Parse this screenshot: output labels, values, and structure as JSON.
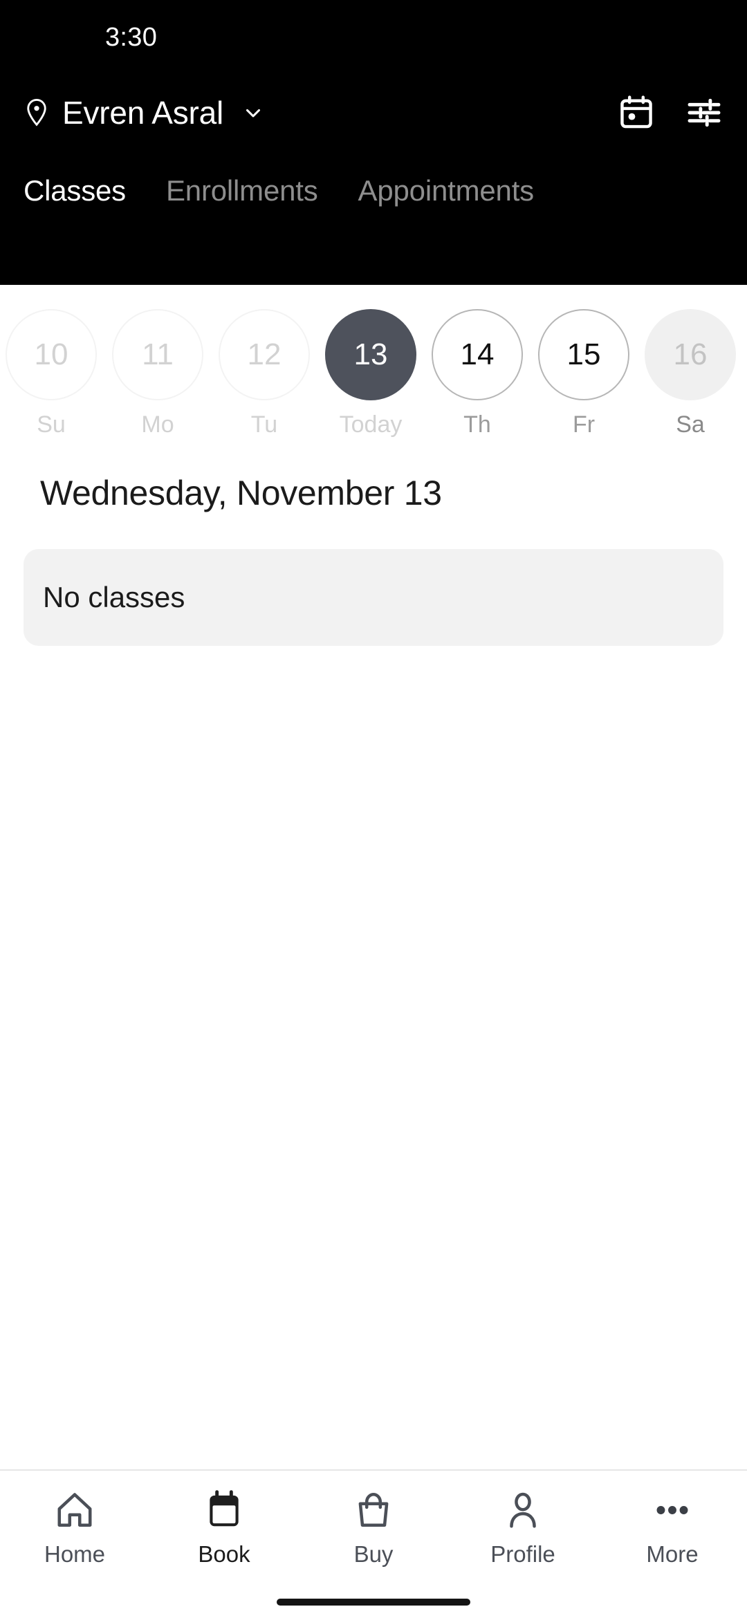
{
  "status_bar": {
    "time": "3:30"
  },
  "app_bar": {
    "pin_icon": "location-pin-icon",
    "location_name": "Evren Asral",
    "chevron_icon": "chevron-down-icon",
    "calendar_icon": "calendar-icon",
    "filter_icon": "filter-sliders-icon"
  },
  "tabs": [
    {
      "label": "Classes",
      "active": true
    },
    {
      "label": "Enrollments",
      "active": false
    },
    {
      "label": "Appointments",
      "active": false
    }
  ],
  "date_strip": [
    {
      "day_number": "10",
      "day_label": "Su",
      "state": "past"
    },
    {
      "day_number": "11",
      "day_label": "Mo",
      "state": "past"
    },
    {
      "day_number": "12",
      "day_label": "Tu",
      "state": "past"
    },
    {
      "day_number": "13",
      "day_label": "Today",
      "state": "today"
    },
    {
      "day_number": "14",
      "day_label": "Th",
      "state": "available"
    },
    {
      "day_number": "15",
      "day_label": "Fr",
      "state": "available"
    },
    {
      "day_number": "16",
      "day_label": "Sa",
      "state": "weekend"
    }
  ],
  "main": {
    "date_heading": "Wednesday, November 13",
    "empty_state": "No classes"
  },
  "bottom_nav": [
    {
      "label": "Home",
      "icon": "home-icon",
      "active": false
    },
    {
      "label": "Book",
      "icon": "calendar-filled-icon",
      "active": true
    },
    {
      "label": "Buy",
      "icon": "shopping-bag-icon",
      "active": false
    },
    {
      "label": "Profile",
      "icon": "person-icon",
      "active": false
    },
    {
      "label": "More",
      "icon": "more-dots-icon",
      "active": false
    }
  ],
  "colors": {
    "header_bg": "#000000",
    "selected_day": "#4e525c",
    "card_bg": "#f2f2f2",
    "tab_inactive": "#8e8e8e",
    "weekend_bg": "#f0f0f0"
  }
}
